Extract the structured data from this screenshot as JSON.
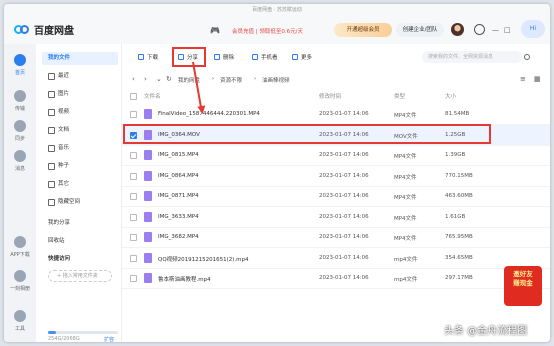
{
  "window": {
    "title": "百度网盘 · 苏苏赋运动"
  },
  "app": {
    "name": "百度网盘"
  },
  "header": {
    "member_link": "会员充值 | 领取低至0.6元/天",
    "vip_button": "开通超级会员",
    "enterprise_button": "创建企业/团队",
    "greeting": "Hi",
    "minimize": "—",
    "maximize": "□",
    "close": "✕"
  },
  "left_nav": [
    {
      "label": "首页",
      "icon": "home-icon",
      "active": true
    },
    {
      "label": "传输",
      "icon": "transfer-icon"
    },
    {
      "label": "同步",
      "icon": "sync-icon"
    },
    {
      "label": "消息",
      "icon": "message-icon"
    },
    {
      "label": "APP下载",
      "icon": "phone-icon"
    },
    {
      "label": "一刻相册",
      "icon": "album-icon"
    },
    {
      "label": "工具",
      "icon": "tools-icon"
    }
  ],
  "sidebar": {
    "my_files": "我的文件",
    "items": [
      {
        "label": "最近",
        "icon": "clock-icon"
      },
      {
        "label": "图片",
        "icon": "image-icon"
      },
      {
        "label": "视频",
        "icon": "video-icon"
      },
      {
        "label": "文档",
        "icon": "document-icon"
      },
      {
        "label": "音乐",
        "icon": "music-icon"
      },
      {
        "label": "种子",
        "icon": "seed-icon"
      },
      {
        "label": "其它",
        "icon": "more-icon"
      },
      {
        "label": "隐藏空间",
        "icon": "lock-icon"
      }
    ],
    "my_share": "我的分享",
    "recycle": "回收站",
    "quick_access": "快捷访问",
    "add_tag": "+ 拖入常用文件夹",
    "storage_text": "254G/2068G",
    "storage_fraction": 0.12,
    "expand": "扩容"
  },
  "toolbar": {
    "download": "下载",
    "share": "分享",
    "delete": "删除",
    "to_phone": "手机看",
    "more": "更多",
    "search_placeholder": "搜索我的文件、全网资源消息"
  },
  "breadcrumb": [
    "我的网盘",
    "资源不限",
    "油画棒视频"
  ],
  "table": {
    "headers": {
      "name": "文件名",
      "date": "修改时间",
      "type": "类型",
      "size": "大小"
    },
    "rows": [
      {
        "name": "FinalVideo_1587446444.220301.MP4",
        "date": "2023-01-07 14:06",
        "type": "MP4文件",
        "size": "81.54MB",
        "icon_color": "#9b7ef0",
        "checked": false
      },
      {
        "name": "IMG_0364.MOV",
        "date": "2023-01-07 14:06",
        "type": "MOV文件",
        "size": "1.25GB",
        "icon_color": "#9b7ef0",
        "checked": true
      },
      {
        "name": "IMG_0815.MP4",
        "date": "2023-01-07 14:06",
        "type": "MP4文件",
        "size": "1.39GB",
        "icon_color": "#9b7ef0",
        "checked": false
      },
      {
        "name": "IMG_0864.MP4",
        "date": "2023-01-07 14:06",
        "type": "MP4文件",
        "size": "770.15MB",
        "icon_color": "#9b7ef0",
        "checked": false
      },
      {
        "name": "IMG_0871.MP4",
        "date": "2023-01-07 14:06",
        "type": "MP4文件",
        "size": "463.60MB",
        "icon_color": "#9b7ef0",
        "checked": false
      },
      {
        "name": "IMG_3633.MP4",
        "date": "2023-01-07 14:06",
        "type": "MP4文件",
        "size": "1.61GB",
        "icon_color": "#9b7ef0",
        "checked": false
      },
      {
        "name": "IMG_3682.MP4",
        "date": "2023-01-07 14:06",
        "type": "MP4文件",
        "size": "765.95MB",
        "icon_color": "#9b7ef0",
        "checked": false
      },
      {
        "name": "QQ视频20191215201651(2).mp4",
        "date": "2023-01-07 14:06",
        "type": "mp4文件",
        "size": "354.65MB",
        "icon_color": "#9b7ef0",
        "checked": false
      },
      {
        "name": "鲁本斯油画教程.mp4",
        "date": "2023-01-07 14:06",
        "type": "mp4文件",
        "size": "297.17MB",
        "icon_color": "#9b7ef0",
        "checked": false
      }
    ]
  },
  "promo": {
    "line1": "邀好友",
    "line2": "赚现金"
  },
  "watermark": "头条 @金舟流程图",
  "colors": {
    "accent": "#2b7df0",
    "highlight": "#e53935",
    "vip": "#f8cf98"
  }
}
